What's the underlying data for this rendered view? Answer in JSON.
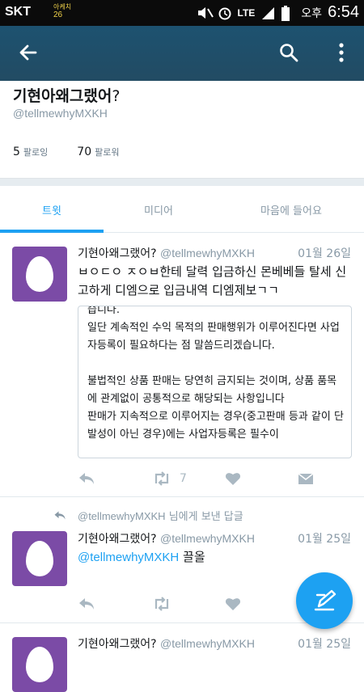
{
  "status_bar": {
    "carrier": "SKT",
    "weather_small": "아케치",
    "weather_temp": "26",
    "network": "LTE",
    "ampm": "오후",
    "time": "6:54"
  },
  "app_bar": {
    "back_icon": "arrow-back-icon",
    "search_icon": "search-icon",
    "more_icon": "more-vertical-icon"
  },
  "profile": {
    "name": "기현아왜그랬어",
    "name_suffix": "?",
    "handle": "@tellmewhyMXKH",
    "following_count": "5",
    "following_label": "팔로잉",
    "followers_count": "70",
    "followers_label": "팔로워"
  },
  "tabs": [
    {
      "label": "트윗"
    },
    {
      "label": "미디어"
    },
    {
      "label": "마음에 들어요"
    }
  ],
  "tweets": [
    {
      "name": "기현아왜그랬어?",
      "handle": "@tellmewhyMXKH",
      "date": "01월 26일",
      "text": "ㅂㅇㄷㅇ ㅈㅇㅂ한테 달력 입금하신 몬베베들 탈세 신고하게 디엠으로 입금내역 디엠제보ㄱㄱ",
      "quote": "습니다.\n일단 계속적인 수익 목적의 판매행위가 이루어진다면 사업자등록이 필요하다는 점 말씀드리겠습니다.\n\n불법적인 상품 판매는 당연히 금지되는 것이며, 상품 품목에 관계없이 공통적으로 해당되는 사항입니다\n판매가 지속적으로 이루어지는 경우(중고판매 등과 같이 단발성이 아닌 경우)에는 사업자등록은 필수이",
      "retweet_count": "7"
    },
    {
      "replied_to": "@tellmewhyMXKH",
      "replied_suffix": "님에게 보낸 답글",
      "name": "기현아왜그랬어?",
      "handle": "@tellmewhyMXKH",
      "date": "01월 25일",
      "mention": "@tellmewhyMXKH",
      "text": "끌올"
    },
    {
      "name": "기현아왜그랬어?",
      "handle": "@tellmewhyMXKH",
      "date": "01월 25일"
    }
  ],
  "fab": {
    "icon": "compose-tweet-icon"
  },
  "colors": {
    "accent": "#1da1f2",
    "app_bar": "#224b63",
    "avatar": "#7b4ba6",
    "muted": "#8899a6"
  }
}
